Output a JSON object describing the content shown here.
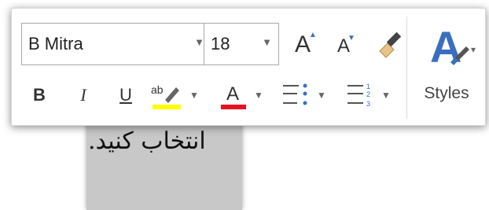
{
  "document": {
    "selected_text": "انتخاب کنید."
  },
  "toolbar": {
    "font_name": "B Mitra",
    "font_size": "18",
    "grow_font_glyph": "A",
    "shrink_font_glyph": "A",
    "bold_glyph": "B",
    "italic_glyph": "I",
    "underline_glyph": "U",
    "highlight_glyph": "ab",
    "font_color_glyph": "A",
    "styles_label": "Styles",
    "colors": {
      "highlight": "#ffff00",
      "font_color": "#e81123",
      "accent": "#3a6fbf"
    },
    "icons": [
      "format-painter-icon",
      "bullets-icon",
      "numbering-icon",
      "styles-icon"
    ]
  }
}
